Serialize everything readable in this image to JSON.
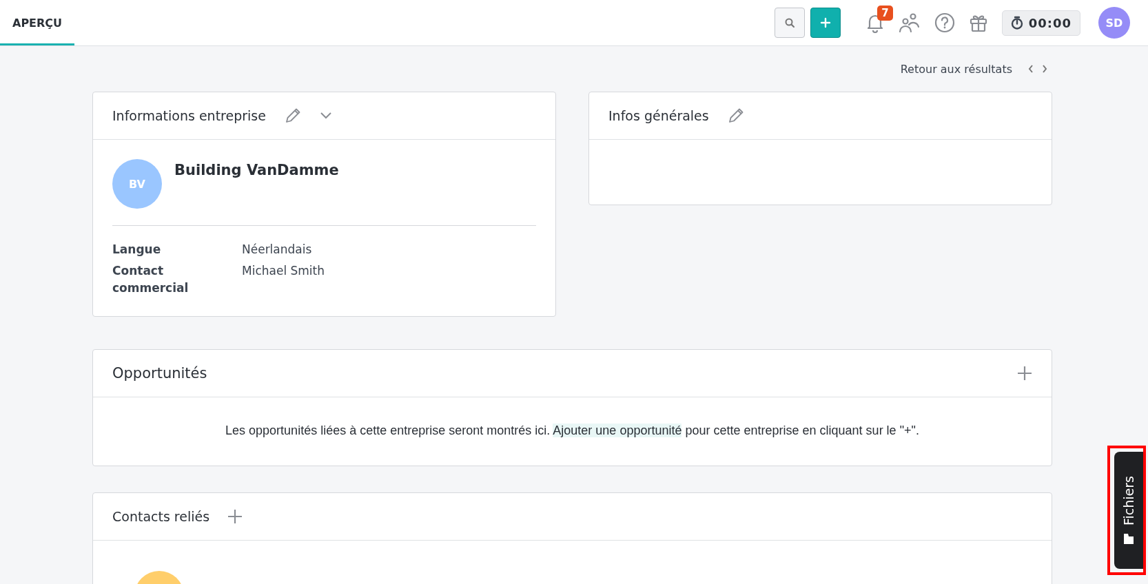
{
  "header": {
    "tabs": [
      {
        "label": "APERÇU",
        "selected": true
      }
    ],
    "notifications": "7",
    "timer": "00:00",
    "avatar": "SD"
  },
  "back_link": "Retour aux résultats",
  "company_card": {
    "title": "Informations entreprise",
    "avatar": "BV",
    "name": "Building VanDamme",
    "fields": [
      {
        "label": "Langue",
        "value": "Néerlandais"
      },
      {
        "label": "Contact commercial",
        "value": "Michael Smith"
      }
    ]
  },
  "general_card": {
    "title": "Infos générales"
  },
  "opportunities": {
    "title": "Opportunités",
    "message_before": "Les opportunités liées à cette entreprise seront montrés ici.",
    "link": "Ajouter une opportunité",
    "message_after": "pour cette entreprise en cliquant sur le \"+\"."
  },
  "contacts": {
    "title": "Contacts reliés"
  },
  "files_tab": {
    "label": "Fichiers",
    "highlighted": true
  }
}
